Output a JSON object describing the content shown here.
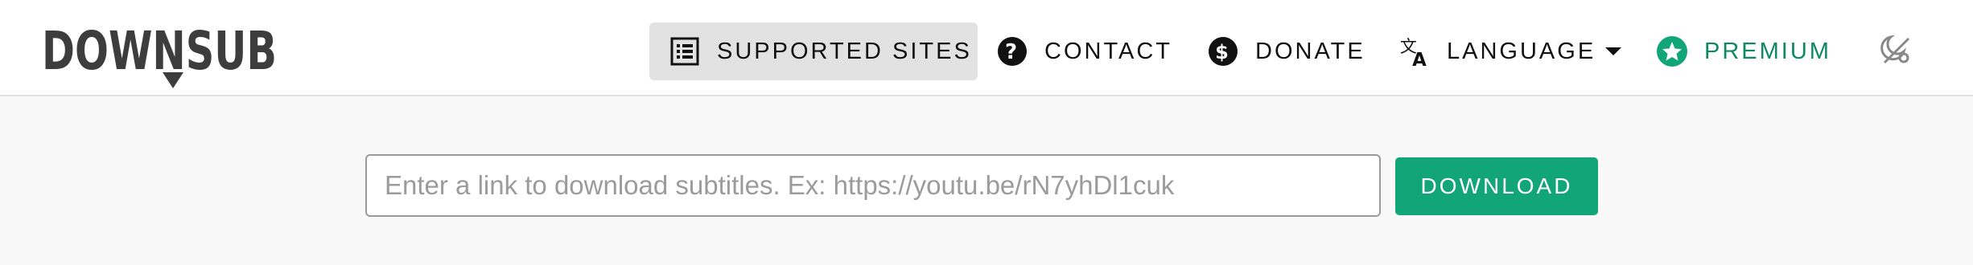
{
  "brand": {
    "logo_text": "DOWNSUB",
    "color": "#3d3d3d"
  },
  "nav": {
    "items": [
      {
        "label": "SUPPORTED SITES",
        "icon": "list-icon",
        "active": true
      },
      {
        "label": "CONTACT",
        "icon": "question-circle-icon"
      },
      {
        "label": "DONATE",
        "icon": "dollar-circle-icon"
      },
      {
        "label": "LANGUAGE",
        "icon": "translate-icon",
        "dropdown": true
      },
      {
        "label": "PREMIUM",
        "icon": "star-circle-icon",
        "color": "#0f8a5f"
      }
    ],
    "theme_toggle_icon": "moon-sun-icon"
  },
  "search": {
    "placeholder": "Enter a link to download subtitles. Ex: https://youtu.be/rN7yhDl1cuk",
    "value": "",
    "button_label": "DOWNLOAD",
    "button_color": "#12a578"
  }
}
